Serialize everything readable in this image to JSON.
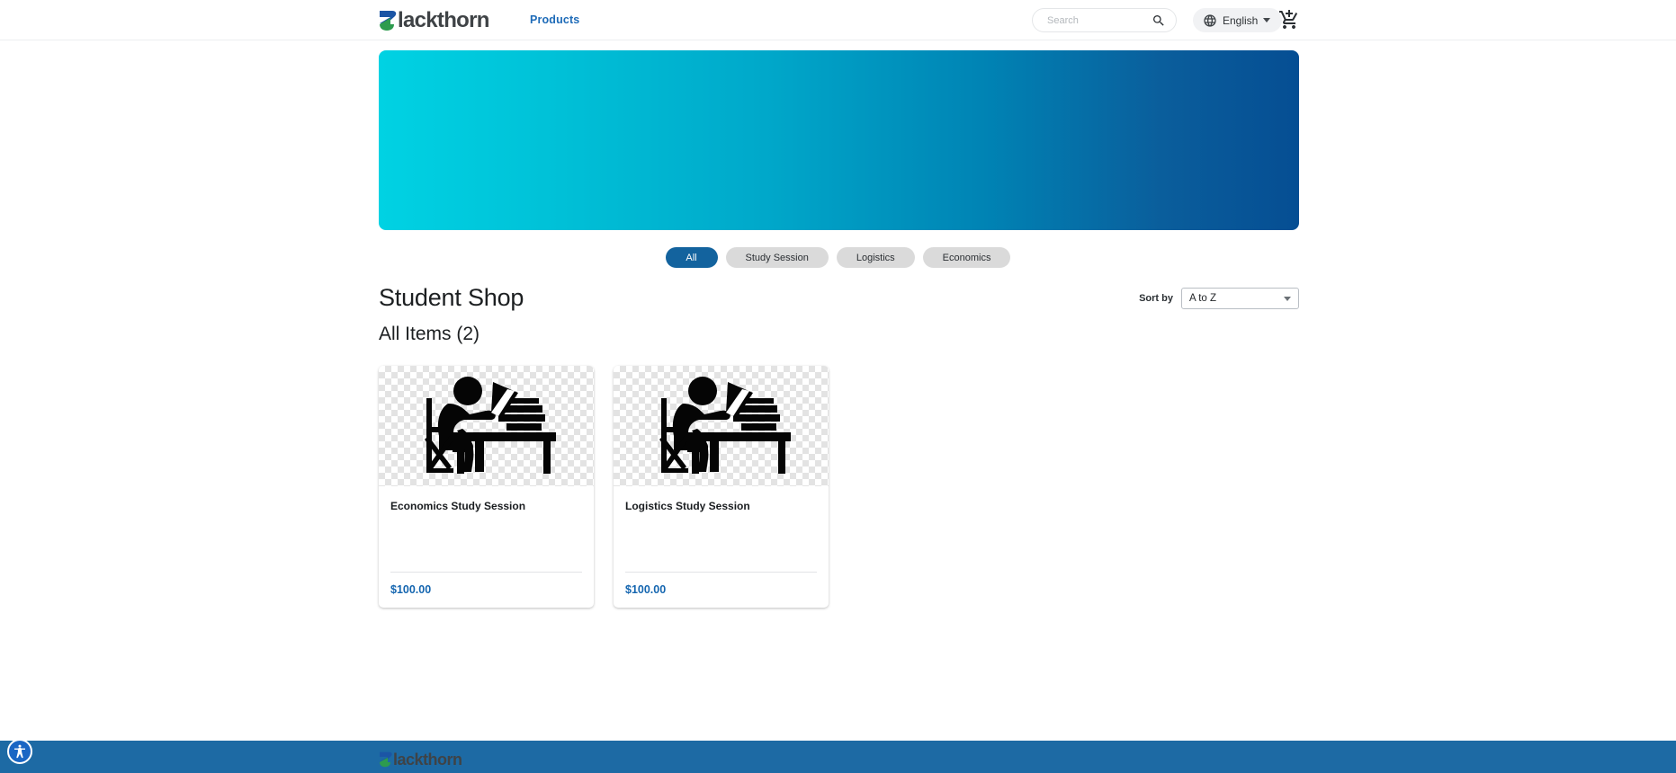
{
  "header": {
    "logo_text": "lackthorn",
    "logo_alt": "Blackthorn",
    "nav": [
      {
        "label": "Products"
      }
    ],
    "search": {
      "placeholder": "Search",
      "value": "",
      "icon": "search-icon"
    },
    "language": {
      "label": "English",
      "icon": "globe-icon",
      "caret": "chevron-down-icon"
    },
    "cart": {
      "icon": "add-shopping-cart-icon",
      "label": "Cart"
    }
  },
  "banner": {
    "gradient_from": "#00d2e3",
    "gradient_to": "#054e93"
  },
  "filters": {
    "items": [
      {
        "label": "All",
        "active": true
      },
      {
        "label": "Study Session",
        "active": false
      },
      {
        "label": "Logistics",
        "active": false
      },
      {
        "label": "Economics",
        "active": false
      }
    ]
  },
  "shop": {
    "title": "Student Shop",
    "subtitle": "All Items (2)",
    "item_count": 2
  },
  "sort": {
    "label": "Sort by",
    "selected": "A to Z",
    "options": [
      "A to Z"
    ]
  },
  "products": [
    {
      "name": "Economics Study Session",
      "price": "$100.00",
      "image_alt": "student-studying-at-desk-icon"
    },
    {
      "name": "Logistics Study Session",
      "price": "$100.00",
      "image_alt": "student-studying-at-desk-icon"
    }
  ],
  "footer": {
    "logo_text": "lackthorn",
    "background": "#1d6aa4"
  },
  "accessibility": {
    "label": "Accessibility",
    "icon": "accessibility-person-icon"
  },
  "colors": {
    "accent_blue": "#13639e",
    "price_blue": "#1566b0",
    "link_blue": "#1e6bb8",
    "pill_gray": "#dadada"
  }
}
